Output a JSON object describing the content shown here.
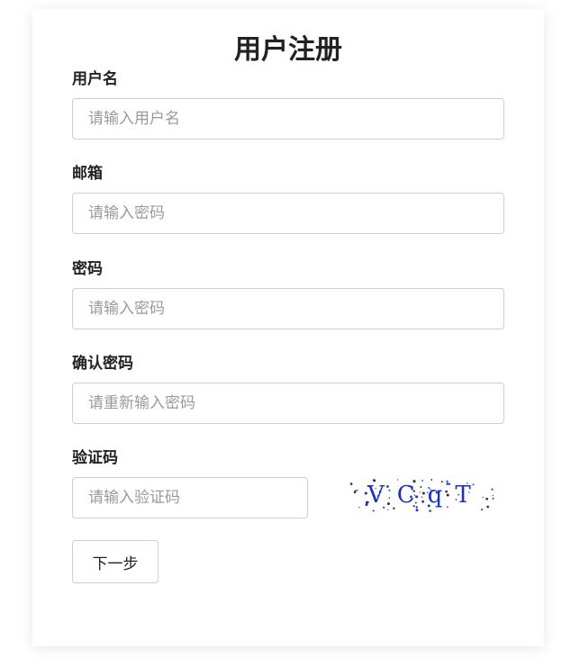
{
  "form": {
    "title": "用户注册",
    "username": {
      "label": "用户名",
      "placeholder": "请输入用户名"
    },
    "email": {
      "label": "邮箱",
      "placeholder": "请输入密码"
    },
    "password": {
      "label": "密码",
      "placeholder": "请输入密码"
    },
    "confirm_password": {
      "label": "确认密码",
      "placeholder": "请重新输入密码"
    },
    "captcha": {
      "label": "验证码",
      "placeholder": "请输入验证码",
      "image_text": "VCqT",
      "text_color": "#1a2fd0"
    },
    "next_button_label": "下一步"
  }
}
